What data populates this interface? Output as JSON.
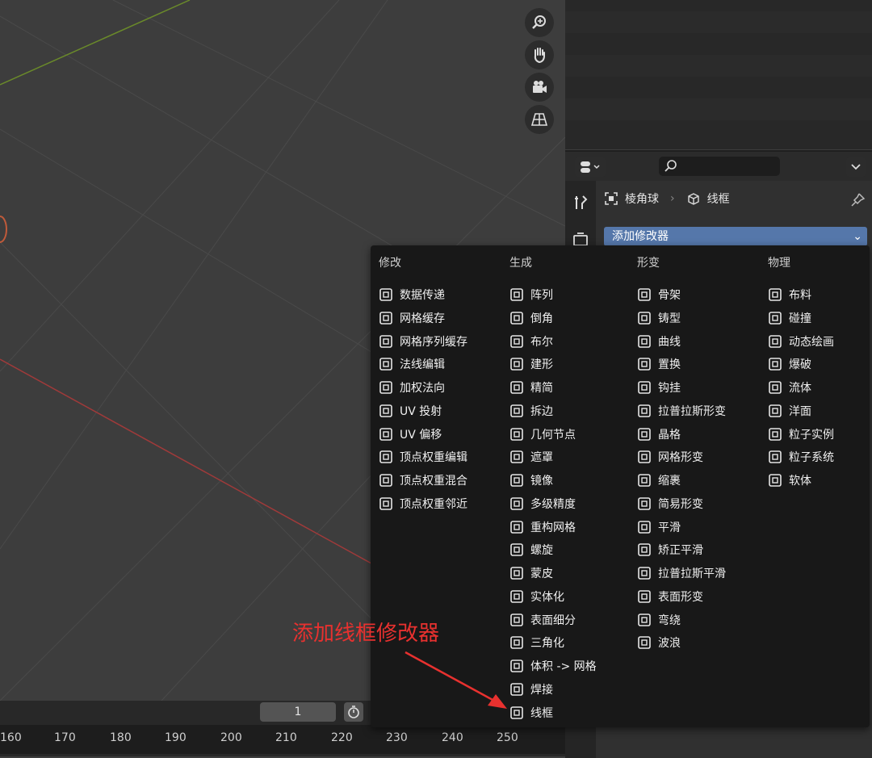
{
  "timeline": {
    "current_frame": "1",
    "ruler_labels": [
      "160",
      "170",
      "180",
      "190",
      "200",
      "210",
      "220",
      "230",
      "240",
      "250"
    ]
  },
  "properties": {
    "breadcrumb_object": "棱角球",
    "breadcrumb_modifier": "线框",
    "add_modifier_label": "添加修改器"
  },
  "popup": {
    "columns": [
      {
        "title": "修改",
        "items": [
          {
            "label": "数据传递",
            "icon": "data-transfer-icon"
          },
          {
            "label": "网格缓存",
            "icon": "mesh-cache-icon"
          },
          {
            "label": "网格序列缓存",
            "icon": "mesh-sequence-cache-icon"
          },
          {
            "label": "法线编辑",
            "icon": "normal-edit-icon"
          },
          {
            "label": "加权法向",
            "icon": "weighted-normal-icon"
          },
          {
            "label": "UV 投射",
            "icon": "uv-project-icon"
          },
          {
            "label": "UV 偏移",
            "icon": "uv-warp-icon"
          },
          {
            "label": "顶点权重编辑",
            "icon": "vertex-weight-edit-icon"
          },
          {
            "label": "顶点权重混合",
            "icon": "vertex-weight-mix-icon"
          },
          {
            "label": "顶点权重邻近",
            "icon": "vertex-weight-proximity-icon"
          }
        ]
      },
      {
        "title": "生成",
        "items": [
          {
            "label": "阵列",
            "icon": "array-icon"
          },
          {
            "label": "倒角",
            "icon": "bevel-icon"
          },
          {
            "label": "布尔",
            "icon": "boolean-icon"
          },
          {
            "label": "建形",
            "icon": "build-icon"
          },
          {
            "label": "精简",
            "icon": "decimate-icon"
          },
          {
            "label": "拆边",
            "icon": "edge-split-icon"
          },
          {
            "label": "几何节点",
            "icon": "geometry-nodes-icon"
          },
          {
            "label": "遮罩",
            "icon": "mask-icon"
          },
          {
            "label": "镜像",
            "icon": "mirror-icon"
          },
          {
            "label": "多级精度",
            "icon": "multires-icon"
          },
          {
            "label": "重构网格",
            "icon": "remesh-icon"
          },
          {
            "label": "螺旋",
            "icon": "screw-icon"
          },
          {
            "label": "蒙皮",
            "icon": "skin-icon"
          },
          {
            "label": "实体化",
            "icon": "solidify-icon"
          },
          {
            "label": "表面细分",
            "icon": "subdivision-icon"
          },
          {
            "label": "三角化",
            "icon": "triangulate-icon"
          },
          {
            "label": "体积 -> 网格",
            "icon": "volume-to-mesh-icon"
          },
          {
            "label": "焊接",
            "icon": "weld-icon"
          },
          {
            "label": "线框",
            "icon": "wireframe-icon"
          }
        ]
      },
      {
        "title": "形变",
        "items": [
          {
            "label": "骨架",
            "icon": "armature-icon"
          },
          {
            "label": "铸型",
            "icon": "cast-icon"
          },
          {
            "label": "曲线",
            "icon": "curve-icon"
          },
          {
            "label": "置换",
            "icon": "displace-icon"
          },
          {
            "label": "钩挂",
            "icon": "hook-icon"
          },
          {
            "label": "拉普拉斯形变",
            "icon": "laplacian-deform-icon"
          },
          {
            "label": "晶格",
            "icon": "lattice-icon"
          },
          {
            "label": "网格形变",
            "icon": "mesh-deform-icon"
          },
          {
            "label": "缩裹",
            "icon": "shrinkwrap-icon"
          },
          {
            "label": "简易形变",
            "icon": "simple-deform-icon"
          },
          {
            "label": "平滑",
            "icon": "smooth-icon"
          },
          {
            "label": "矫正平滑",
            "icon": "corrective-smooth-icon"
          },
          {
            "label": "拉普拉斯平滑",
            "icon": "laplacian-smooth-icon"
          },
          {
            "label": "表面形变",
            "icon": "surface-deform-icon"
          },
          {
            "label": "弯绕",
            "icon": "warp-icon"
          },
          {
            "label": "波浪",
            "icon": "wave-icon"
          }
        ]
      },
      {
        "title": "物理",
        "items": [
          {
            "label": "布料",
            "icon": "cloth-icon"
          },
          {
            "label": "碰撞",
            "icon": "collision-icon"
          },
          {
            "label": "动态绘画",
            "icon": "dynamic-paint-icon"
          },
          {
            "label": "爆破",
            "icon": "explode-icon"
          },
          {
            "label": "流体",
            "icon": "fluid-icon"
          },
          {
            "label": "洋面",
            "icon": "ocean-icon"
          },
          {
            "label": "粒子实例",
            "icon": "particle-instance-icon"
          },
          {
            "label": "粒子系统",
            "icon": "particle-system-icon"
          },
          {
            "label": "软体",
            "icon": "soft-body-icon"
          }
        ]
      }
    ]
  },
  "annotation": {
    "text": "添加线框修改器",
    "color": "#e8312f"
  },
  "colors": {
    "accent": "#5577aa",
    "popup_bg": "#181818",
    "viewport_bg": "#3d3d3d"
  }
}
